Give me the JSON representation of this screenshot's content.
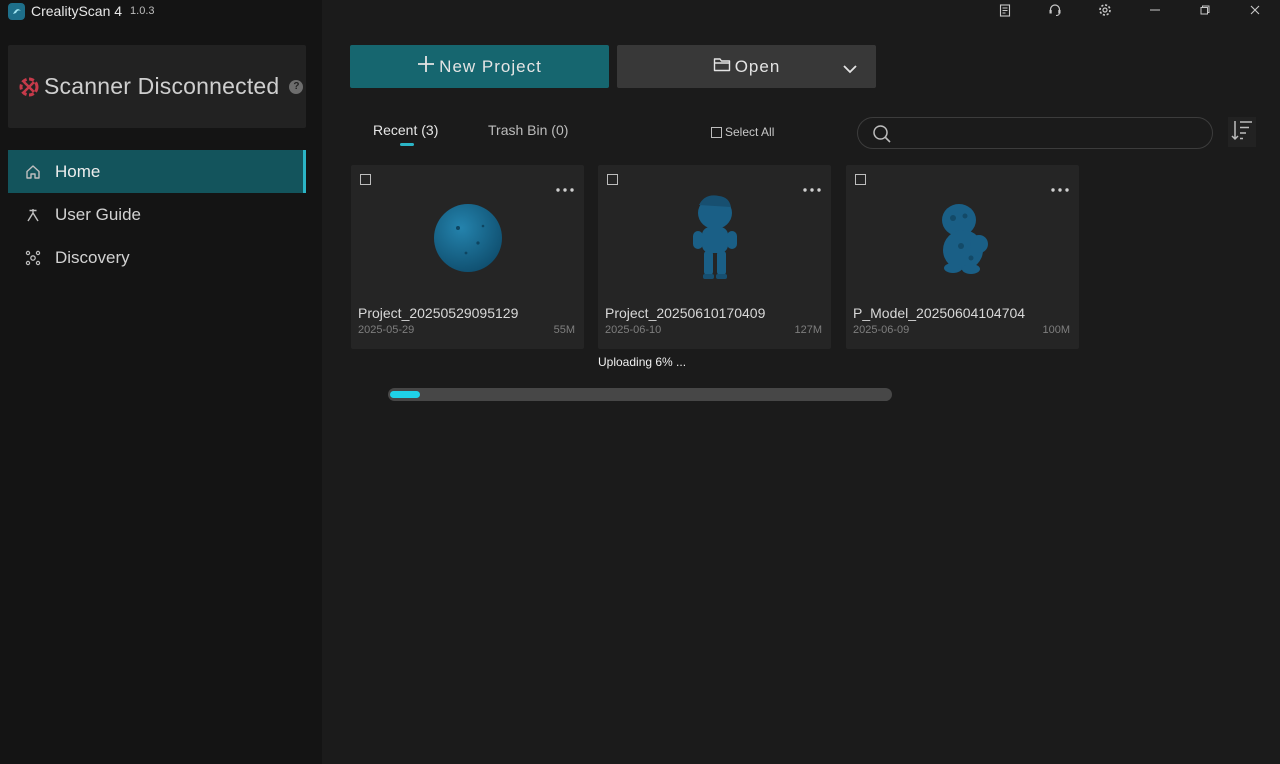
{
  "app": {
    "title": "CrealityScan 4",
    "version": "1.0.3"
  },
  "scanner": {
    "status": "Scanner Disconnected",
    "help_glyph": "?",
    "status_color": "#c63a4a"
  },
  "sidebar": {
    "items": [
      {
        "label": "Home",
        "icon": "home-icon",
        "active": true
      },
      {
        "label": "User Guide",
        "icon": "user-guide-icon",
        "active": false
      },
      {
        "label": "Discovery",
        "icon": "discovery-icon",
        "active": false
      }
    ]
  },
  "toolbar": {
    "new_project_label": "New Project",
    "open_label": "Open"
  },
  "tabs": {
    "recent": "Recent (3)",
    "trash": "Trash Bin (0)"
  },
  "select_all_label": "Select All",
  "search": {
    "placeholder": ""
  },
  "projects": [
    {
      "name": "Project_20250529095129",
      "date": "2025-05-29",
      "size": "55M",
      "thumb": "sphere"
    },
    {
      "name": "Project_20250610170409",
      "date": "2025-06-10",
      "size": "127M",
      "thumb": "figure"
    },
    {
      "name": "P_Model_20250604104704",
      "date": "2025-06-09",
      "size": "100M",
      "thumb": "figure2"
    }
  ],
  "upload": {
    "text": "Uploading 6% ...",
    "progress": 0.06
  },
  "colors": {
    "accent": "#2bb5c6",
    "primary_button": "#16666f",
    "progress_fill": "#1fd2e8",
    "model": "#1a5f86"
  }
}
